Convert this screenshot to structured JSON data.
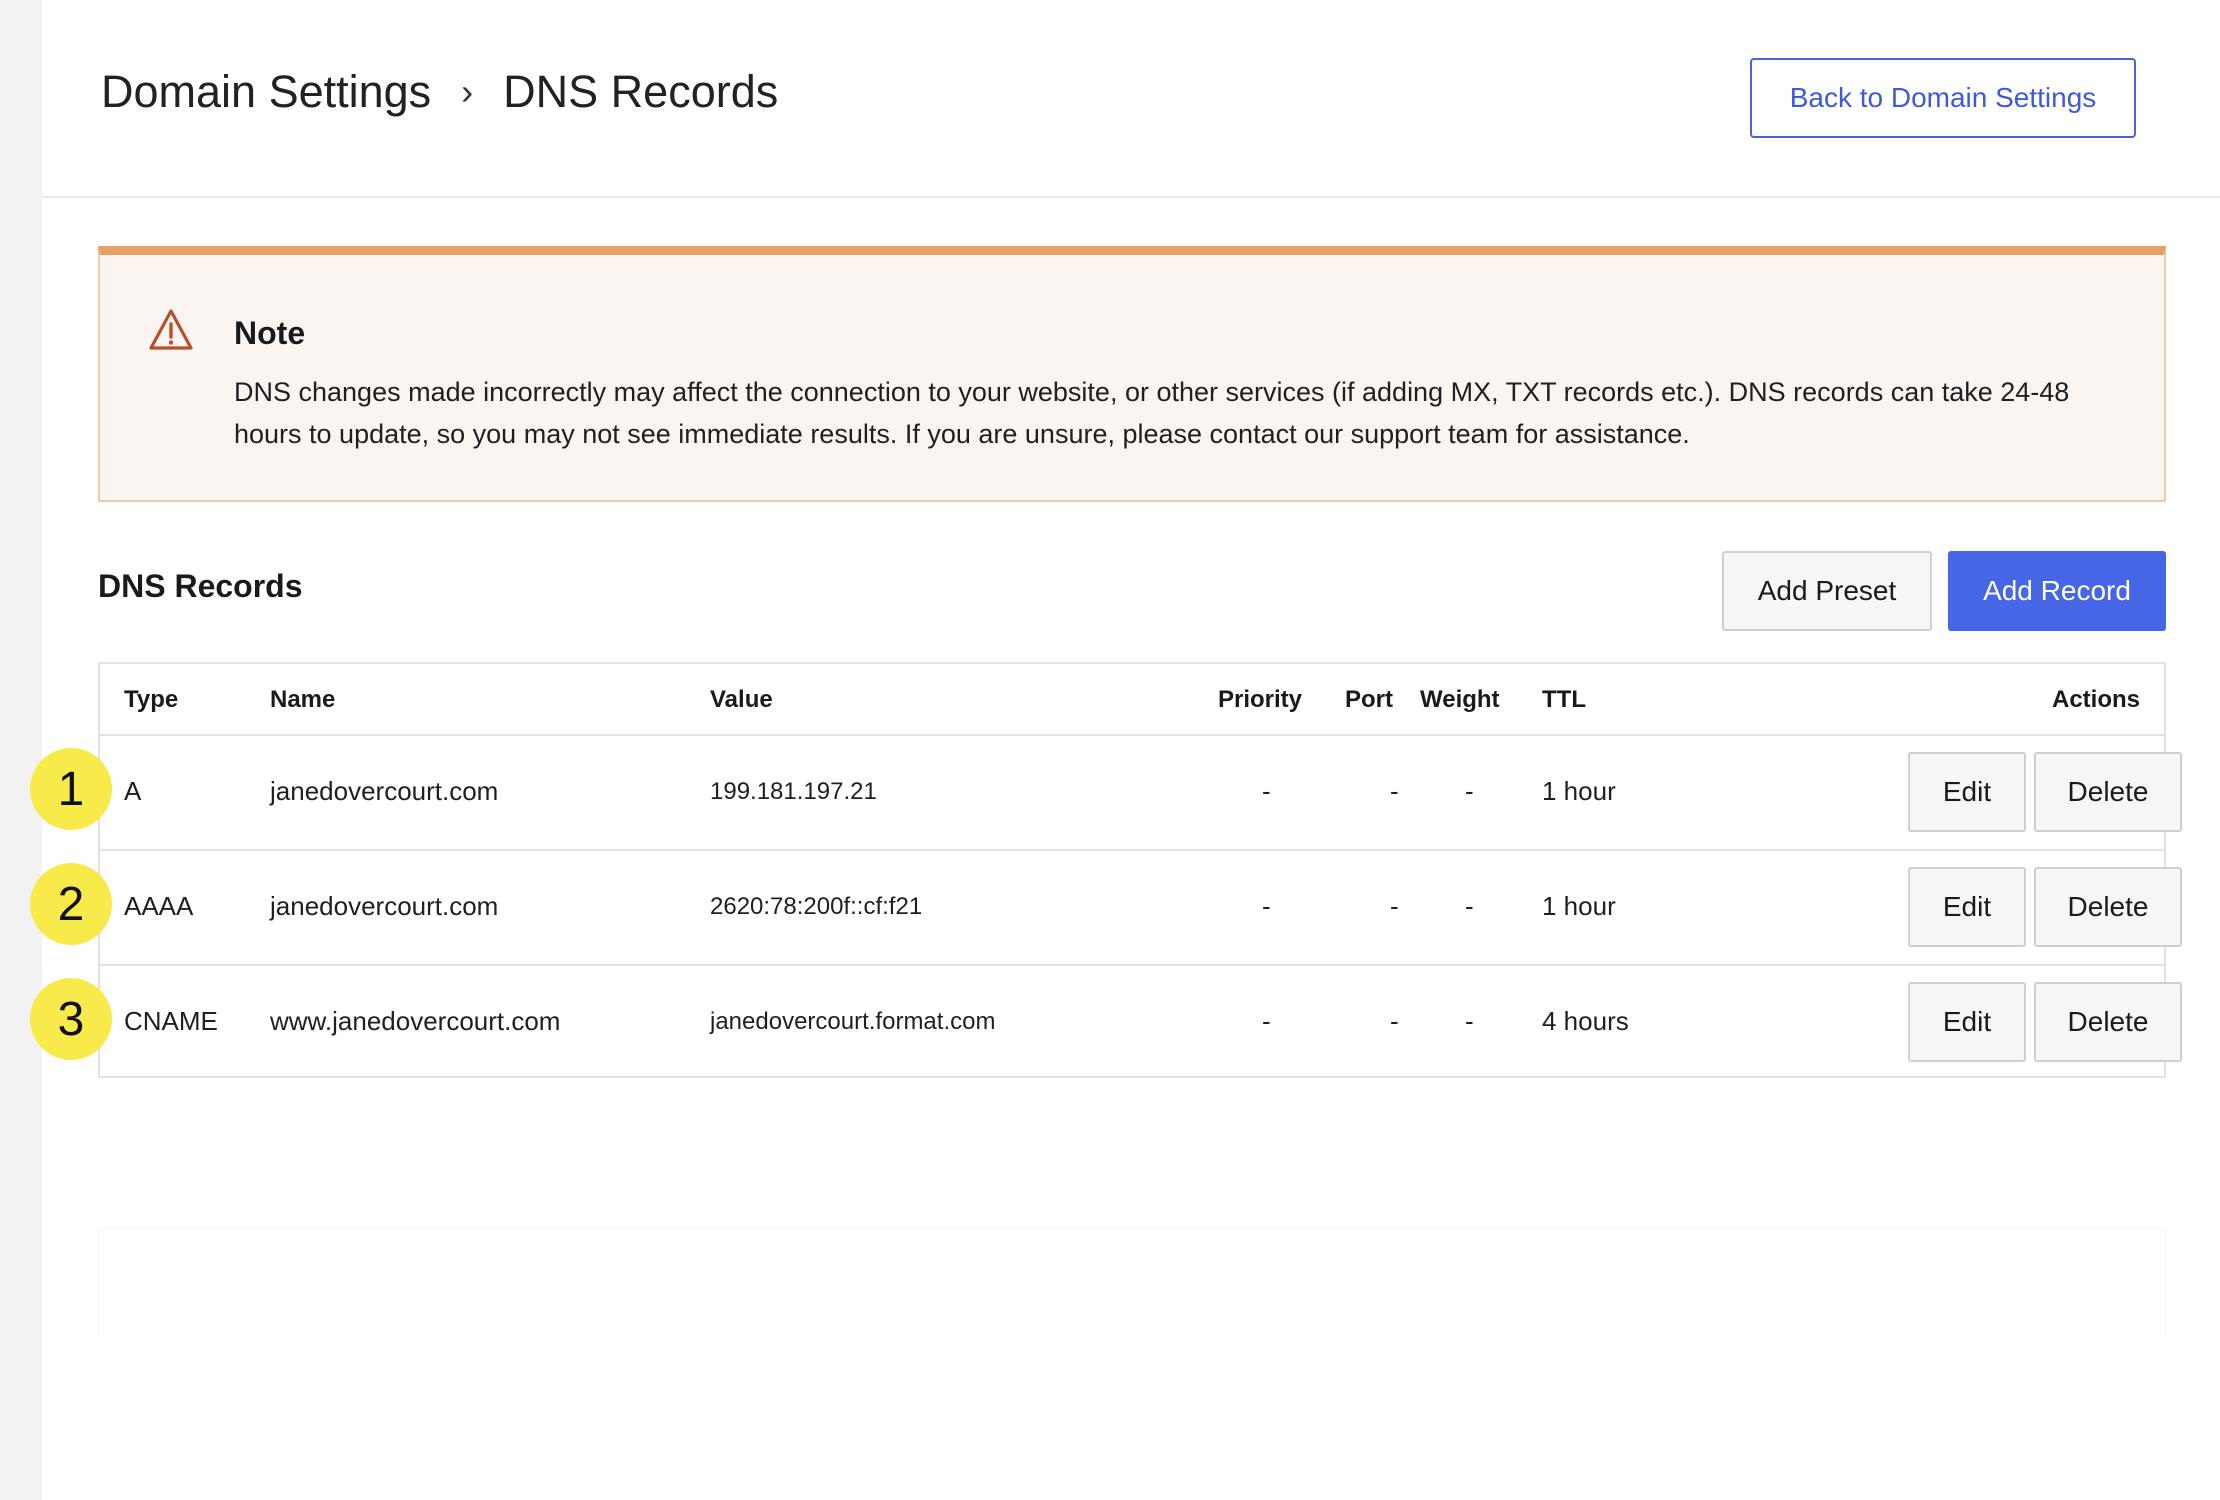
{
  "breadcrumb": {
    "parent": "Domain Settings",
    "separator": "›",
    "current": "DNS Records"
  },
  "header": {
    "back_button": "Back to Domain Settings"
  },
  "note": {
    "title": "Note",
    "body": "DNS changes made incorrectly may affect the connection to your website, or other services (if adding MX, TXT records etc.). DNS records can take 24-48 hours to update, so you may not see immediate results. If you are unsure, please contact our support team for assistance.",
    "icon": "warning-triangle-icon",
    "accent_color": "#e8a06a"
  },
  "records_section": {
    "title": "DNS Records",
    "add_preset_label": "Add Preset",
    "add_record_label": "Add Record"
  },
  "table": {
    "columns": [
      "Type",
      "Name",
      "Value",
      "Priority",
      "Port",
      "Weight",
      "TTL",
      "Actions"
    ],
    "rows": [
      {
        "badge": "1",
        "type": "A",
        "name": "janedovercourt.com",
        "value": "199.181.197.21",
        "priority": "-",
        "port": "-",
        "weight": "-",
        "ttl": "1 hour",
        "edit": "Edit",
        "delete": "Delete"
      },
      {
        "badge": "2",
        "type": "AAAA",
        "name": "janedovercourt.com",
        "value": "2620:78:200f::cf:f21",
        "priority": "-",
        "port": "-",
        "weight": "-",
        "ttl": "1 hour",
        "edit": "Edit",
        "delete": "Delete"
      },
      {
        "badge": "3",
        "type": "CNAME",
        "name": "www.janedovercourt.com",
        "value": "janedovercourt.format.com",
        "priority": "-",
        "port": "-",
        "weight": "-",
        "ttl": "4 hours",
        "edit": "Edit",
        "delete": "Delete"
      }
    ]
  },
  "colors": {
    "primary": "#4766e6",
    "badge": "#f8ea4a"
  }
}
